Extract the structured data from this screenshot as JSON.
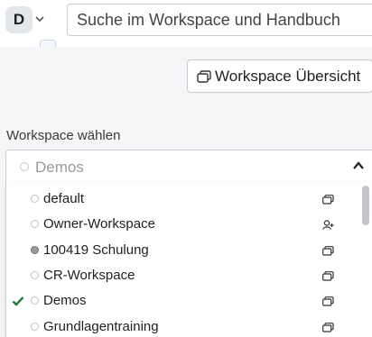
{
  "header": {
    "avatar_letter": "D",
    "search_placeholder": "Suche im Workspace und Handbuch"
  },
  "overview_button": {
    "label": "Workspace Übersicht",
    "icon": "stack-icon"
  },
  "workspace_select": {
    "label": "Workspace wählen",
    "selected_value": "Demos",
    "icon": "chevron-up-icon",
    "options": [
      {
        "label": "default",
        "icon": "stack-icon",
        "checked": false,
        "dot": "empty"
      },
      {
        "label": "Owner-Workspace",
        "icon": "user-plus-icon",
        "checked": false,
        "dot": "empty"
      },
      {
        "label": "100419 Schulung",
        "icon": "stack-icon",
        "checked": false,
        "dot": "filled"
      },
      {
        "label": "CR-Workspace",
        "icon": "stack-icon",
        "checked": false,
        "dot": "empty"
      },
      {
        "label": "Demos",
        "icon": "stack-icon",
        "checked": true,
        "dot": "empty"
      },
      {
        "label": "Grundlagentraining",
        "icon": "stack-icon",
        "checked": false,
        "dot": "empty"
      }
    ]
  },
  "colors": {
    "check": "#1f7a3a",
    "panel_bg": "#f5f6f8",
    "border": "#c9ccd1"
  }
}
